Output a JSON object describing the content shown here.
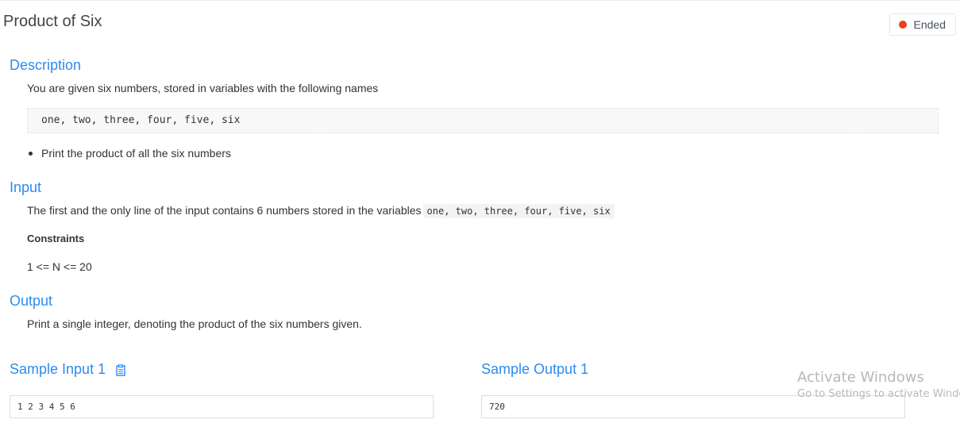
{
  "problem": {
    "title": "Product of Six",
    "status": "Ended",
    "status_color": "#ed3f14"
  },
  "description": {
    "heading": "Description",
    "intro": "You are given six numbers, stored in variables with the following names",
    "code": "one, two, three, four, five, six",
    "bullets": [
      "Print the product of all the six numbers"
    ]
  },
  "input": {
    "heading": "Input",
    "text": "The first and the only line of the input contains 6 numbers stored in the variables",
    "inline_code": "one, two, three, four, five, six",
    "constraints_heading": "Constraints",
    "constraints_text": "1 <= N <= 20"
  },
  "output": {
    "heading": "Output",
    "text": "Print a single integer, denoting the product of the six numbers given."
  },
  "samples": {
    "input_heading": "Sample Input 1",
    "input_value": "1 2 3 4 5 6",
    "output_heading": "Sample Output 1",
    "output_value": "720",
    "copy_icon": "clipboard-icon"
  },
  "watermark": {
    "line1": "Activate Windows",
    "line2": "Go to Settings to activate Windows."
  },
  "colors": {
    "accent": "#2d8cf0",
    "status": "#ed3f14"
  }
}
